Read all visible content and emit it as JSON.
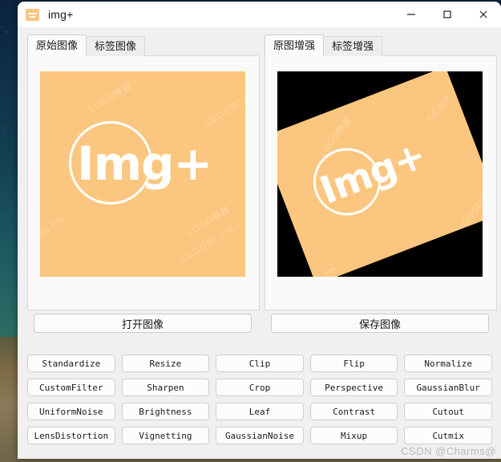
{
  "window": {
    "title": "img+",
    "icon": "app-logo-icon",
    "controls": {
      "minimize": "minimize-icon",
      "maximize": "maximize-icon",
      "close": "close-icon"
    }
  },
  "left_panel": {
    "tabs": [
      {
        "label": "原始图像",
        "active": true
      },
      {
        "label": "标签图像",
        "active": false
      }
    ],
    "preview": {
      "logo_text": "Img+",
      "background_color": "#fbc67f",
      "stage_background": "#fbc67f",
      "watermarks": [
        "LOGO神器",
        "LOGOSC.CN",
        "SC.CN",
        "LOGO神器",
        "LOGOSC.CN"
      ]
    },
    "action_label": "打开图像"
  },
  "right_panel": {
    "tabs": [
      {
        "label": "原图增强",
        "active": true
      },
      {
        "label": "标签增强",
        "active": false
      }
    ],
    "preview": {
      "logo_text": "Img+",
      "background_color": "#fbc67f",
      "stage_background": "#000000",
      "rotation_deg": -21,
      "watermarks": [
        "LOGO神器",
        "SC.CN",
        "SC.CN",
        "LOGOSC.C",
        "LOGO神器"
      ]
    },
    "action_label": "保存图像"
  },
  "operations": [
    "Standardize",
    "Resize",
    "Clip",
    "Flip",
    "Normalize",
    "CustomFilter",
    "Sharpen",
    "Crop",
    "Perspective",
    "GaussianBlur",
    "UniformNoise",
    "Brightness",
    "Leaf",
    "Contrast",
    "Cutout",
    "LensDistortion",
    "Vignetting",
    "GaussianNoise",
    "Mixup",
    "Cutmix"
  ],
  "watermark": "CSDN @Charms@"
}
